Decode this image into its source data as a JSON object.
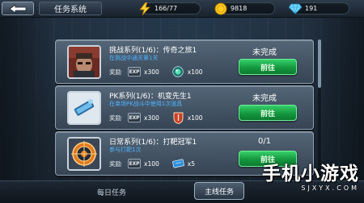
{
  "header": {
    "title": "任务系统",
    "back_icon": "back-arrow-icon"
  },
  "resources": {
    "energy": "166/77",
    "gold": "9818",
    "gems": "191"
  },
  "tasks": [
    {
      "name": "挑战系列(1/6)：传奇之旅1",
      "desc": "在挑战中通关第1关",
      "status": "未完成",
      "reward_label": "奖励",
      "exp_badge": "EXP",
      "exp_amount": "x300",
      "item_amount": "x100",
      "button": "前往",
      "item_icon": "green-orb-icon"
    },
    {
      "name": "PK系列(1/6)：机变先生1",
      "desc": "在单场PK战斗中使用1次道具",
      "status": "未完成",
      "reward_label": "奖励",
      "exp_badge": "EXP",
      "exp_amount": "x300",
      "item_amount": "x100",
      "button": "前往",
      "item_icon": "shield-badge-icon"
    },
    {
      "name": "日常系列(1/6)：打靶冠军1",
      "desc": "参与打靶1次",
      "status": "0/1",
      "reward_label": "奖励",
      "exp_badge": "EXP",
      "exp_amount": "x100",
      "item_amount": "x5",
      "button": "前往",
      "item_icon": "ticket-icon"
    }
  ],
  "tabs": {
    "daily": "每日任务",
    "main": "主线任务"
  },
  "watermark": {
    "text": "手机小游戏",
    "url": "SJXYX.COM"
  },
  "colors": {
    "accent_green": "#15973f",
    "desc_blue": "#4fb4ff"
  }
}
